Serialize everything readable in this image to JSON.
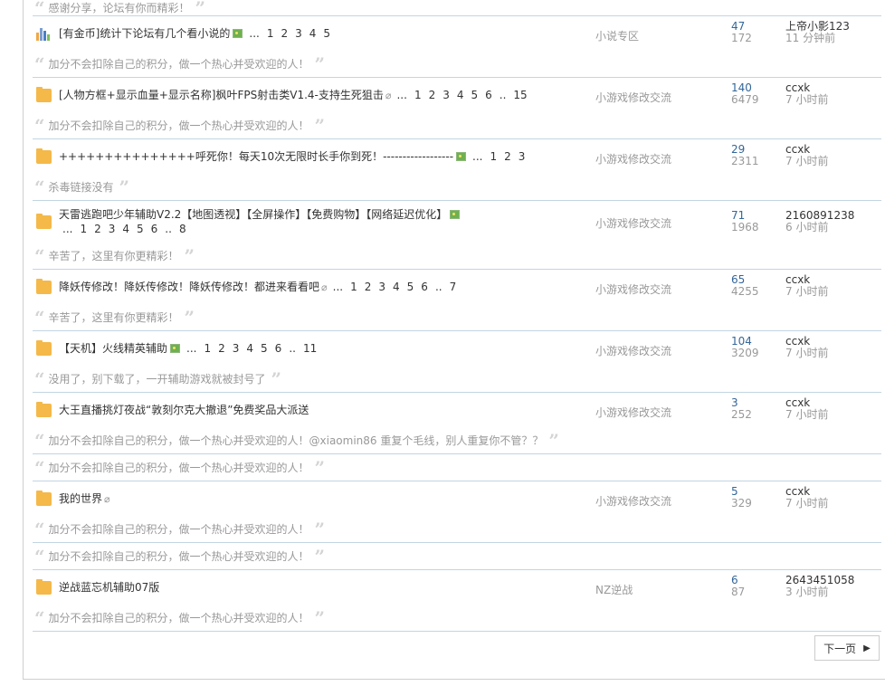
{
  "threads": [
    {
      "quote_before": "感谢分享，论坛有你而精彩！",
      "icon": "poll-icon",
      "title": "[有金币]统计下论坛有几个看小说的",
      "has_image": true,
      "has_attachment": false,
      "pages": [
        "...",
        "1",
        "2",
        "3",
        "4",
        "5"
      ],
      "forum": "小说专区",
      "replies": "47",
      "views": "172",
      "last_user": "上帝小影123",
      "last_time": "11 分钟前",
      "quotes_after": [
        "加分不会扣除自己的积分，做一个热心并受欢迎的人！"
      ]
    },
    {
      "icon": "folder-icon",
      "title": "[人物方框+显示血量+显示名称]枫叶FPS射击类V1.4-支持生死狙击",
      "has_image": false,
      "has_attachment": true,
      "pages": [
        "...",
        "1",
        "2",
        "3",
        "4",
        "5",
        "6",
        "..",
        "15"
      ],
      "forum": "小游戏修改交流",
      "replies": "140",
      "views": "6479",
      "last_user": "ccxk",
      "last_time": "7 小时前",
      "quotes_after": [
        "加分不会扣除自己的积分，做一个热心并受欢迎的人！"
      ]
    },
    {
      "icon": "folder-icon",
      "title": "+++++++++++++++呼死你！每天10次无限时长手你到死！------------------",
      "has_image": true,
      "has_attachment": false,
      "pages": [
        "...",
        "1",
        "2",
        "3"
      ],
      "forum": "小游戏修改交流",
      "replies": "29",
      "views": "2311",
      "last_user": "ccxk",
      "last_time": "7 小时前",
      "quotes_after": [
        "杀毒链接没有"
      ]
    },
    {
      "icon": "folder-icon",
      "title": "天雷逃跑吧少年辅助V2.2【地图透视】【全屏操作】【免费购物】【网络延迟优化】",
      "has_image": true,
      "has_attachment": false,
      "pages": [
        "...",
        "1",
        "2",
        "3",
        "4",
        "5",
        "6",
        "..",
        "8"
      ],
      "forum": "小游戏修改交流",
      "replies": "71",
      "views": "1968",
      "last_user": "2160891238",
      "last_time": "6 小时前",
      "quotes_after": [
        "辛苦了，这里有你更精彩！"
      ]
    },
    {
      "icon": "folder-icon",
      "title": "降妖传修改！降妖传修改！降妖传修改！都进来看看吧",
      "has_image": false,
      "has_attachment": true,
      "pages": [
        "...",
        "1",
        "2",
        "3",
        "4",
        "5",
        "6",
        "..",
        "7"
      ],
      "forum": "小游戏修改交流",
      "replies": "65",
      "views": "4255",
      "last_user": "ccxk",
      "last_time": "7 小时前",
      "quotes_after": [
        "辛苦了，这里有你更精彩！"
      ]
    },
    {
      "icon": "folder-icon",
      "title": "【天机】火线精英辅助",
      "has_image": true,
      "has_attachment": false,
      "pages": [
        "...",
        "1",
        "2",
        "3",
        "4",
        "5",
        "6",
        "..",
        "11"
      ],
      "forum": "小游戏修改交流",
      "replies": "104",
      "views": "3209",
      "last_user": "ccxk",
      "last_time": "7 小时前",
      "quotes_after": [
        "没用了，别下载了，一开辅助游戏就被封号了"
      ]
    },
    {
      "icon": "folder-icon",
      "title": "大王直播挑灯夜战“敦刻尔克大撤退”免费奖品大派送",
      "has_image": false,
      "has_attachment": false,
      "pages": [],
      "forum": "小游戏修改交流",
      "replies": "3",
      "views": "252",
      "last_user": "ccxk",
      "last_time": "7 小时前",
      "quotes_after": [
        "加分不会扣除自己的积分，做一个热心并受欢迎的人！@xiaomin86 重复个毛线，别人重复你不管？？",
        "加分不会扣除自己的积分，做一个热心并受欢迎的人！"
      ]
    },
    {
      "icon": "folder-icon",
      "title": "我的世界",
      "has_image": false,
      "has_attachment": true,
      "pages": [],
      "forum": "小游戏修改交流",
      "replies": "5",
      "views": "329",
      "last_user": "ccxk",
      "last_time": "7 小时前",
      "quotes_after": [
        "加分不会扣除自己的积分，做一个热心并受欢迎的人！",
        "加分不会扣除自己的积分，做一个热心并受欢迎的人！"
      ]
    },
    {
      "icon": "folder-icon",
      "title": "逆战蓝忘机辅助07版",
      "has_image": false,
      "has_attachment": false,
      "pages": [],
      "forum": "NZ逆战",
      "replies": "6",
      "views": "87",
      "last_user": "2643451058",
      "last_time": "3 小时前",
      "quotes_after": [
        "加分不会扣除自己的积分，做一个热心并受欢迎的人！"
      ]
    }
  ],
  "pagination": {
    "next_label": "下一页"
  }
}
